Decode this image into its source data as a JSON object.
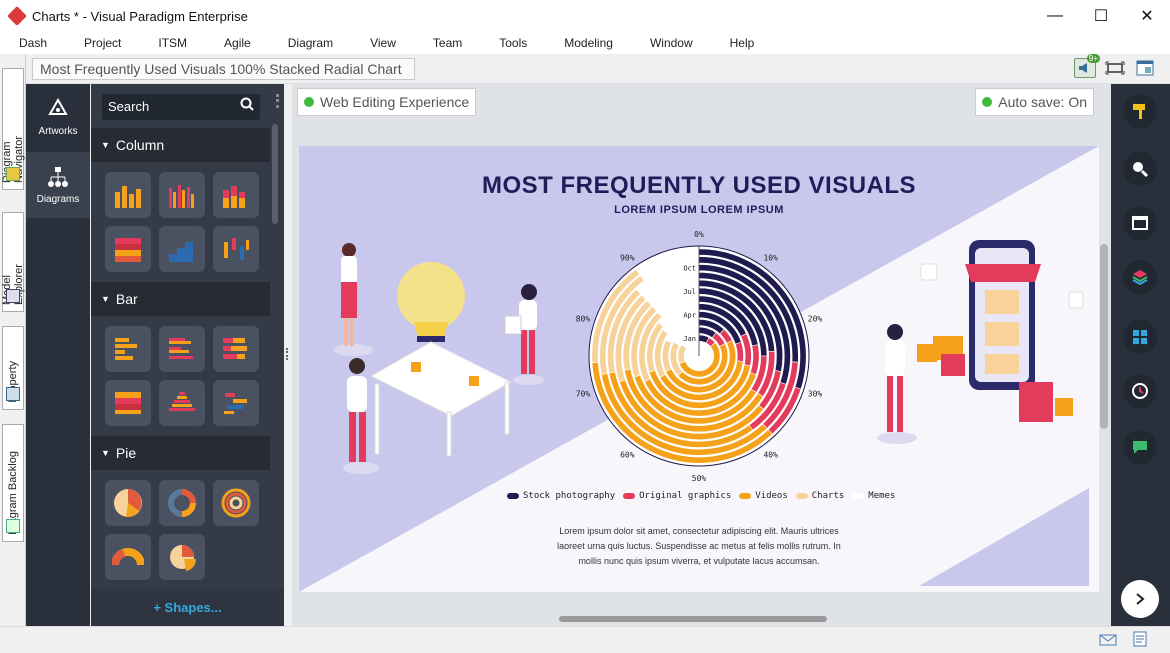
{
  "window": {
    "title": "Charts * - Visual Paradigm Enterprise",
    "min": "—",
    "max": "☐",
    "close": "✕"
  },
  "menu": [
    "Dash",
    "Project",
    "ITSM",
    "Agile",
    "Diagram",
    "View",
    "Team",
    "Tools",
    "Modeling",
    "Window",
    "Help"
  ],
  "breadcrumb": "Most Frequently Used Visuals 100% Stacked Radial Chart",
  "toolbar": {
    "notify_badge": "9+"
  },
  "left_tabs": [
    "Diagram Navigator",
    "Model Explorer",
    "Property",
    "Diagram Backlog"
  ],
  "nav": {
    "artworks": "Artworks",
    "diagrams": "Diagrams"
  },
  "panel": {
    "search_placeholder": "Search",
    "sections": [
      "Column",
      "Bar",
      "Pie"
    ],
    "shapes_link": "+ Shapes..."
  },
  "canvas": {
    "web_editing": "Web Editing Experience",
    "autosave": "Auto save: On"
  },
  "poster": {
    "title": "MOST FREQUENTLY USED VISUALS",
    "subtitle": "LOREM IPSUM LOREM IPSUM",
    "lorem1": "Lorem ipsum dolor sit amet, consectetur adipiscing elit. Mauris ultrices",
    "lorem2": "laoreet urna quis luctus. Suspendisse ac metus at felis mollis rutrum. In",
    "lorem3": "mollis nunc quis ipsum viverra, et vulputate lacus accumsan."
  },
  "chart_data": {
    "type": "radial-stacked-bar",
    "angle_ticks": [
      "0%",
      "10%",
      "20%",
      "30%",
      "40%",
      "50%",
      "60%",
      "70%",
      "80%",
      "90%"
    ],
    "categories": [
      "Jan",
      "",
      "",
      "Apr",
      "",
      "",
      "Jul",
      "",
      "",
      "Oct",
      "",
      ""
    ],
    "series": [
      {
        "name": "Stock photography",
        "color": "#1f1b4e"
      },
      {
        "name": "Original graphics",
        "color": "#e23b5c"
      },
      {
        "name": "Videos",
        "color": "#f5a11a"
      },
      {
        "name": "Charts",
        "color": "#f7d29a"
      },
      {
        "name": "Memes",
        "color": "#ffffff"
      }
    ],
    "values": [
      [
        0.08,
        0.06,
        0.55,
        0.15,
        0.16
      ],
      [
        0.1,
        0.08,
        0.45,
        0.2,
        0.17
      ],
      [
        0.12,
        0.06,
        0.5,
        0.14,
        0.18
      ],
      [
        0.2,
        0.07,
        0.4,
        0.18,
        0.15
      ],
      [
        0.18,
        0.1,
        0.42,
        0.16,
        0.14
      ],
      [
        0.22,
        0.08,
        0.38,
        0.2,
        0.12
      ],
      [
        0.25,
        0.09,
        0.36,
        0.18,
        0.12
      ],
      [
        0.24,
        0.1,
        0.38,
        0.16,
        0.12
      ],
      [
        0.28,
        0.08,
        0.34,
        0.18,
        0.12
      ],
      [
        0.3,
        0.1,
        0.32,
        0.16,
        0.12
      ],
      [
        0.26,
        0.12,
        0.34,
        0.18,
        0.1
      ],
      [
        0.3,
        0.08,
        0.36,
        0.16,
        0.1
      ]
    ]
  }
}
